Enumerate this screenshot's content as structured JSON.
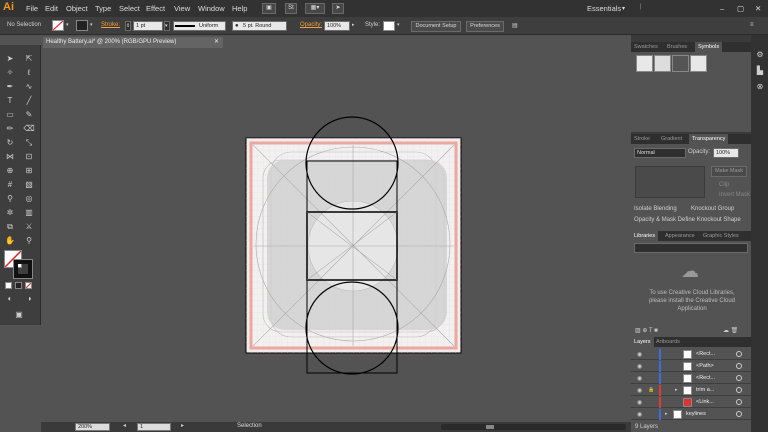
{
  "app": {
    "logo": "Ai"
  },
  "menu": [
    "File",
    "Edit",
    "Object",
    "Type",
    "Select",
    "Effect",
    "View",
    "Window",
    "Help"
  ],
  "menu_extra": {
    "layout_badge": "St",
    "workspace": "Essentials"
  },
  "control": {
    "selection_label": "No Selection",
    "stroke_label": "Stroke:",
    "stroke_weight": "1 pt",
    "profile": "Uniform",
    "brush": "5 pt. Round",
    "opacity_label": "Opacity:",
    "opacity_value": "100%",
    "style_label": "Style:",
    "doc_setup": "Document Setup",
    "preferences": "Preferences"
  },
  "document": {
    "tab_title": "Healthy Battery.ai* @ 200% (RGB/GPU Preview)"
  },
  "status": {
    "zoom": "200%",
    "artboard": "1",
    "tool": "Selection"
  },
  "panels": {
    "top_tabs": [
      "Swatches",
      "Brushes",
      "Symbols"
    ],
    "mid_tabs": [
      "Stroke",
      "Gradient",
      "Transparency"
    ],
    "blend_mode": "Normal",
    "opacity_label": "Opacity:",
    "opacity_value": "100%",
    "make_mask": "Make Mask",
    "clip": "Clip",
    "invert_mask": "Invert Mask",
    "isolate": "Isolate Blending",
    "knockout": "Knockout Group",
    "opacity_mask": "Opacity & Mask Define Knockout Shape",
    "lib_tabs": [
      "Libraries",
      "Appearance",
      "Graphic Styles"
    ],
    "lib_message": "To use Creative Cloud Libraries, please install the Creative Cloud Application",
    "layer_tabs": [
      "Layers",
      "Artboards"
    ],
    "layers": [
      {
        "name": "<Rect...",
        "color": "#3a6fe0"
      },
      {
        "name": "<Path>",
        "color": "#3a6fe0"
      },
      {
        "name": "<Rect...",
        "color": "#3a6fe0"
      },
      {
        "name": "trim a...",
        "color": "#e03a3a"
      },
      {
        "name": "<Link...",
        "color": "#e03a3a"
      },
      {
        "name": "keylines",
        "color": "#3a6fe0"
      }
    ],
    "layer_count": "9 Layers"
  }
}
